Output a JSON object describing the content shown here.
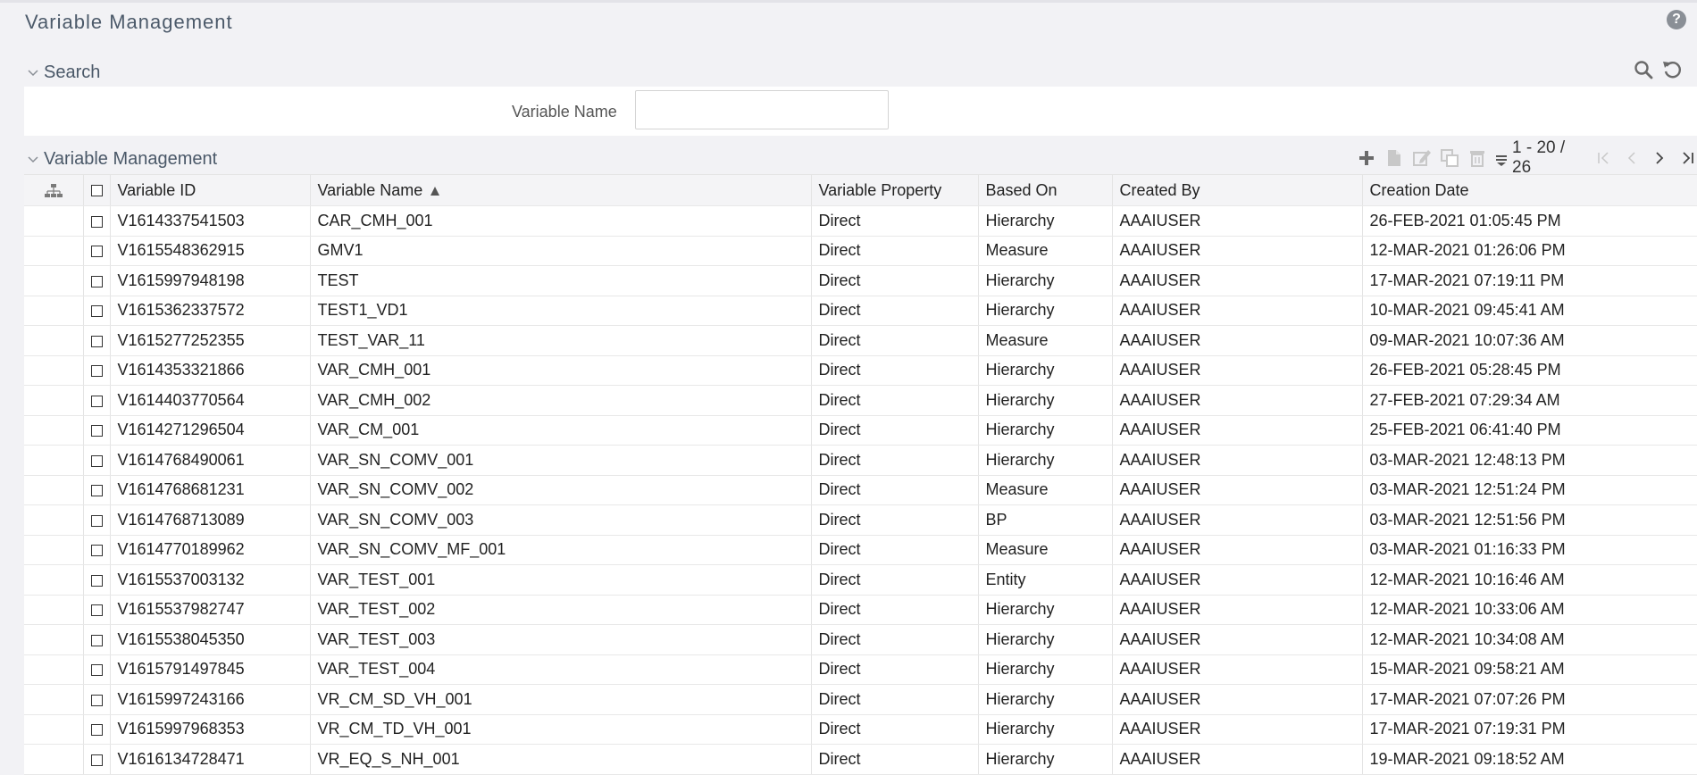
{
  "page": {
    "title": "Variable Management"
  },
  "search": {
    "title": "Search",
    "variable_name_label": "Variable Name",
    "variable_name_value": "",
    "variable_name_placeholder": ""
  },
  "grid_section": {
    "title": "Variable Management",
    "pager": "1 - 20 / 26",
    "columns": [
      "Variable ID",
      "Variable Name",
      "Variable Property",
      "Based On",
      "Created By",
      "Creation Date"
    ],
    "rows": [
      [
        "V1614337541503",
        "CAR_CMH_001",
        "Direct",
        "Hierarchy",
        "AAAIUSER",
        "26-FEB-2021 01:05:45 PM"
      ],
      [
        "V1615548362915",
        "GMV1",
        "Direct",
        "Measure",
        "AAAIUSER",
        "12-MAR-2021 01:26:06 PM"
      ],
      [
        "V1615997948198",
        "TEST",
        "Direct",
        "Hierarchy",
        "AAAIUSER",
        "17-MAR-2021 07:19:11 PM"
      ],
      [
        "V1615362337572",
        "TEST1_VD1",
        "Direct",
        "Hierarchy",
        "AAAIUSER",
        "10-MAR-2021 09:45:41 AM"
      ],
      [
        "V1615277252355",
        "TEST_VAR_11",
        "Direct",
        "Measure",
        "AAAIUSER",
        "09-MAR-2021 10:07:36 AM"
      ],
      [
        "V1614353321866",
        "VAR_CMH_001",
        "Direct",
        "Hierarchy",
        "AAAIUSER",
        "26-FEB-2021 05:28:45 PM"
      ],
      [
        "V1614403770564",
        "VAR_CMH_002",
        "Direct",
        "Hierarchy",
        "AAAIUSER",
        "27-FEB-2021 07:29:34 AM"
      ],
      [
        "V1614271296504",
        "VAR_CM_001",
        "Direct",
        "Hierarchy",
        "AAAIUSER",
        "25-FEB-2021 06:41:40 PM"
      ],
      [
        "V1614768490061",
        "VAR_SN_COMV_001",
        "Direct",
        "Hierarchy",
        "AAAIUSER",
        "03-MAR-2021 12:48:13 PM"
      ],
      [
        "V1614768681231",
        "VAR_SN_COMV_002",
        "Direct",
        "Measure",
        "AAAIUSER",
        "03-MAR-2021 12:51:24 PM"
      ],
      [
        "V1614768713089",
        "VAR_SN_COMV_003",
        "Direct",
        "BP",
        "AAAIUSER",
        "03-MAR-2021 12:51:56 PM"
      ],
      [
        "V1614770189962",
        "VAR_SN_COMV_MF_001",
        "Direct",
        "Measure",
        "AAAIUSER",
        "03-MAR-2021 01:16:33 PM"
      ],
      [
        "V1615537003132",
        "VAR_TEST_001",
        "Direct",
        "Entity",
        "AAAIUSER",
        "12-MAR-2021 10:16:46 AM"
      ],
      [
        "V1615537982747",
        "VAR_TEST_002",
        "Direct",
        "Hierarchy",
        "AAAIUSER",
        "12-MAR-2021 10:33:06 AM"
      ],
      [
        "V1615538045350",
        "VAR_TEST_003",
        "Direct",
        "Hierarchy",
        "AAAIUSER",
        "12-MAR-2021 10:34:08 AM"
      ],
      [
        "V1615791497845",
        "VAR_TEST_004",
        "Direct",
        "Hierarchy",
        "AAAIUSER",
        "15-MAR-2021 09:58:21 AM"
      ],
      [
        "V1615997243166",
        "VR_CM_SD_VH_001",
        "Direct",
        "Hierarchy",
        "AAAIUSER",
        "17-MAR-2021 07:07:26 PM"
      ],
      [
        "V1615997968353",
        "VR_CM_TD_VH_001",
        "Direct",
        "Hierarchy",
        "AAAIUSER",
        "17-MAR-2021 07:19:31 PM"
      ],
      [
        "V1616134728471",
        "VR_EQ_S_NH_001",
        "Direct",
        "Hierarchy",
        "AAAIUSER",
        "19-MAR-2021 09:18:52 AM"
      ]
    ]
  },
  "icons": {
    "help": "help-icon",
    "search": "search-icon",
    "reset": "reset-icon",
    "add": "add-icon",
    "view": "view-icon",
    "edit": "edit-icon",
    "copy": "copy-icon",
    "delete": "delete-icon",
    "hierarchy": "hierarchy-icon",
    "sort": "sort-ascending-icon"
  },
  "colors": {
    "accent": "#4a5868",
    "disabled_icon": "#c8c8c8",
    "active_icon": "#6a6a6a"
  }
}
